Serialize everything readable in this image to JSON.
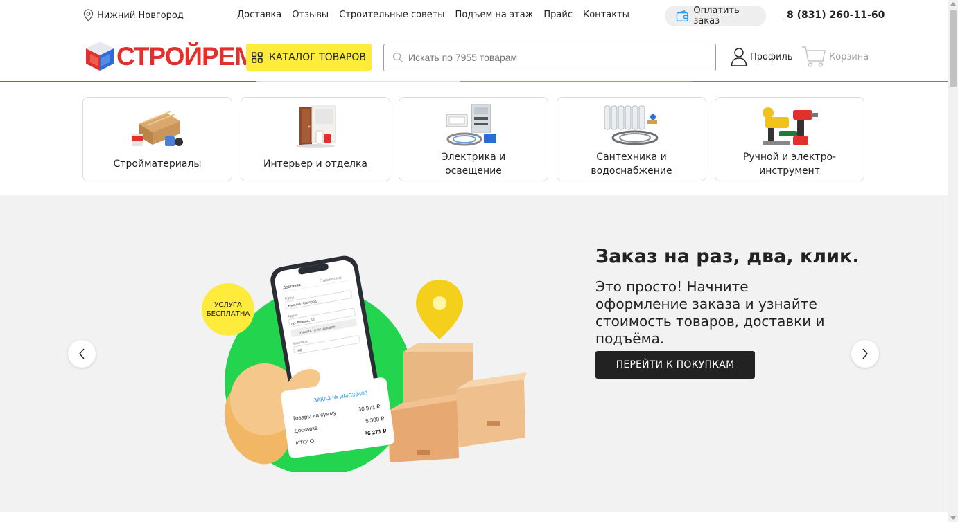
{
  "topbar": {
    "city": "Нижний Новгород",
    "nav": [
      "Доставка",
      "Отзывы",
      "Строительные советы",
      "Подъем на этаж",
      "Прайс",
      "Контакты"
    ],
    "pay_label": "Оплатить заказ",
    "phone": "8 (831) 260-11-60"
  },
  "header": {
    "logo_text": "СТРОЙРЕМ",
    "catalog_label": "КАТАЛОГ ТОВАРОВ",
    "search_placeholder": "Искать по 7955 товарам",
    "profile_label": "Профиль",
    "cart_label": "Корзина"
  },
  "categories": [
    {
      "line1": "Стройматериалы",
      "line2": ""
    },
    {
      "line1": "Интерьер и отделка",
      "line2": ""
    },
    {
      "line1": "Электрика и",
      "line2": "освещение"
    },
    {
      "line1": "Сантехника и",
      "line2": "водоснабжение"
    },
    {
      "line1": "Ручной и электро-",
      "line2": "инструмент"
    }
  ],
  "banner": {
    "title": "Заказ на раз, два, клик.",
    "text": "Это просто! Начните оформление заказа и узнайте стоимость товаров, доставки и подъёма.",
    "button_label": "ПЕРЕЙТИ К ПОКУПКАМ",
    "badge_line1": "УСЛУГА",
    "badge_line2": "БЕСПЛАТНА",
    "receipt": {
      "title": "ЗАКАЗ № ИМС32400",
      "row1_label": "Товары на сумму",
      "row1_value": "30 971 ₽",
      "row2_label": "Доставка",
      "row2_value": "5 300 ₽",
      "total_label": "ИТОГО",
      "total_value": "36 271 ₽"
    },
    "phone_screen": {
      "tab1": "Доставка",
      "tab2": "Самовывоз",
      "city_label": "Город",
      "city_value": "Нижний Новгород",
      "addr_label": "Адрес",
      "addr_value": "пр. Ленина, 60",
      "map_btn": "Указать точку на карте",
      "flat_label": "Квартира",
      "flat_value": "200"
    }
  },
  "colors": {
    "accent_yellow": "#ffeb3b",
    "logo_red": "#e2302c",
    "banner_green": "#22d44e",
    "line_red": "#e53935",
    "line_yellow": "#ffee58",
    "line_green": "#43d34b",
    "line_blue": "#2196f3"
  },
  "icons": [
    "location-pin-icon",
    "wallet-icon",
    "grid-icon",
    "search-icon",
    "user-icon",
    "cart-icon",
    "chevron-left-icon",
    "chevron-right-icon"
  ]
}
